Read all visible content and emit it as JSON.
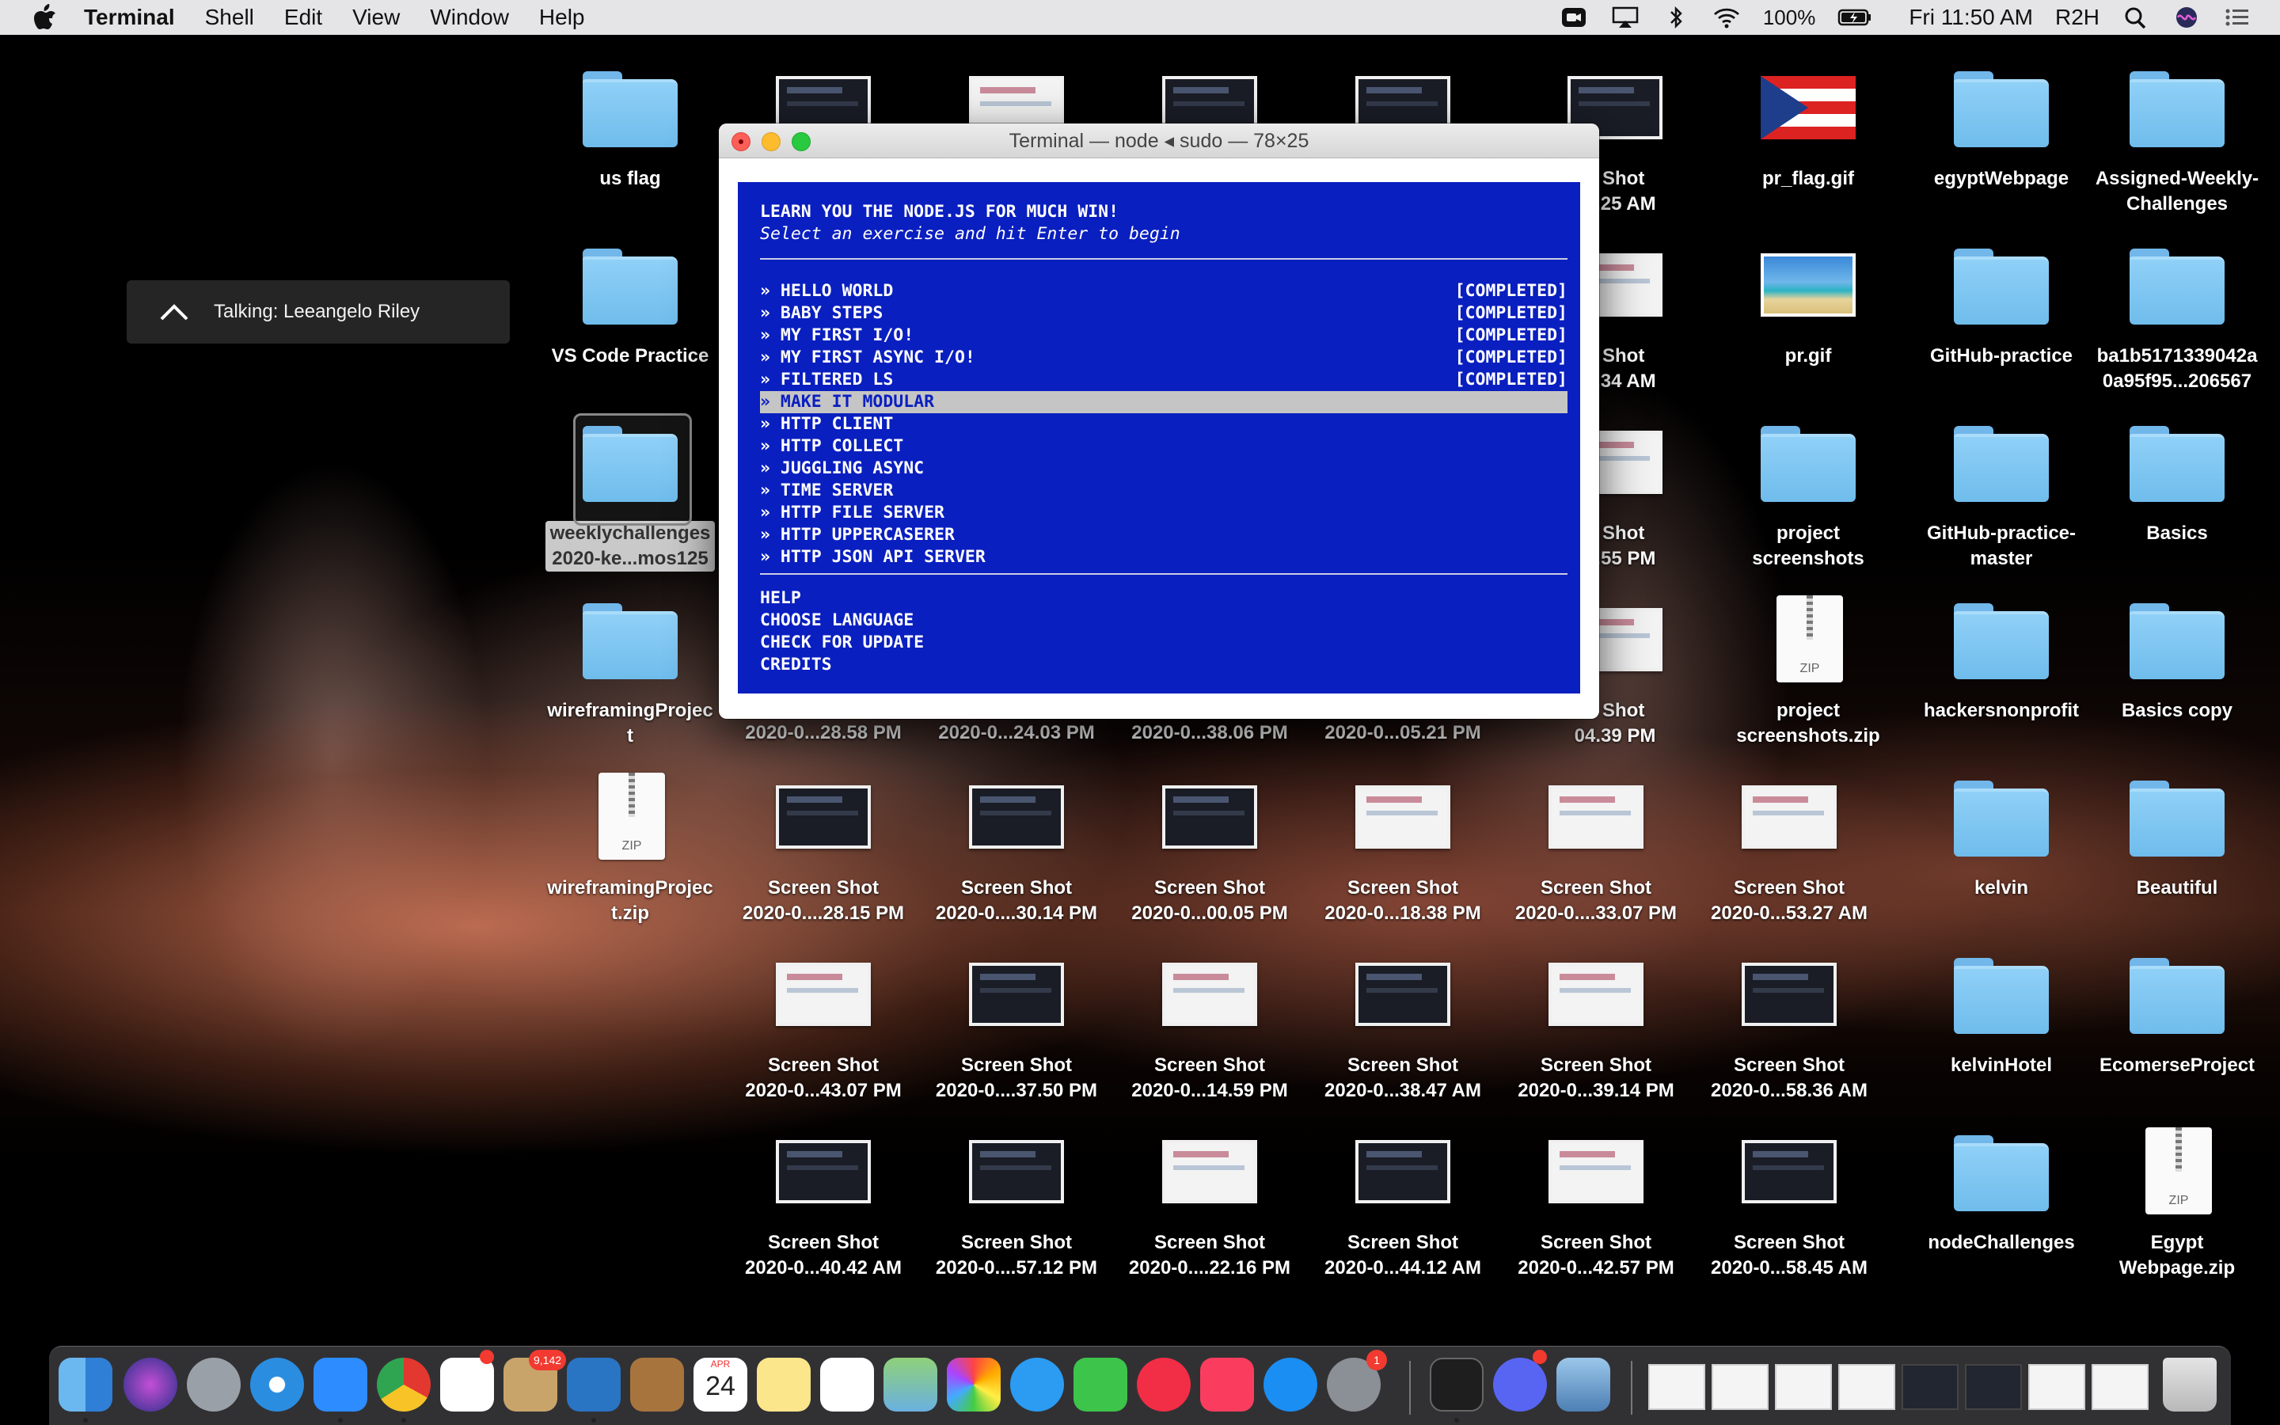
{
  "menubar": {
    "app": "Terminal",
    "items": [
      "Shell",
      "Edit",
      "View",
      "Window",
      "Help"
    ],
    "battery": "100%",
    "clock": "Fri 11:50 AM",
    "user": "R2H"
  },
  "notification": {
    "text": "Talking: Leeangelo Riley"
  },
  "desktop": {
    "icons": [
      {
        "label": "us flag"
      },
      {
        "label": "VS Code Practice"
      },
      {
        "label": "weeklychallenges\n2020-ke...mos125"
      },
      {
        "label": "wireframingProjec\nt"
      },
      {
        "label": "wireframingProjec\nt.zip",
        "zip_text": "ZIP"
      },
      {
        "label": "n Shot\n56.25 AM"
      },
      {
        "label": "n Shot\n56.34 AM"
      },
      {
        "label": "n Shot\n54.55 PM"
      },
      {
        "label": "n Shot\n04.39 PM"
      },
      {
        "label": "pr_flag.gif"
      },
      {
        "label": "pr.gif"
      },
      {
        "label": "project\nscreenshots"
      },
      {
        "label": "project\nscreenshots.zip",
        "zip_text": "ZIP"
      },
      {
        "label": "egyptWebpage"
      },
      {
        "label": "GitHub-practice"
      },
      {
        "label": "GitHub-practice-\nmaster"
      },
      {
        "label": "hackersnonprofit"
      },
      {
        "label": "kelvin"
      },
      {
        "label": "kelvinHotel"
      },
      {
        "label": "nodeChallenges"
      },
      {
        "label": "Assigned-Weekly-\nChallenges"
      },
      {
        "label": "ba1b5171339042a\n0a95f95...206567"
      },
      {
        "label": "Basics"
      },
      {
        "label": "Basics copy"
      },
      {
        "label": "Beautiful"
      },
      {
        "label": "EcomerseProject"
      },
      {
        "label": "Egypt\nWebpage.zip",
        "zip_text": "ZIP"
      },
      {
        "label": "2020-0...28.58 PM"
      },
      {
        "label": "2020-0...24.03 PM"
      },
      {
        "label": "2020-0...38.06 PM"
      },
      {
        "label": "2020-0...05.21 PM"
      },
      {
        "label": "Screen Shot\n2020-0....28.15 PM"
      },
      {
        "label": "Screen Shot\n2020-0....30.14 PM"
      },
      {
        "label": "Screen Shot\n2020-0...00.05 PM"
      },
      {
        "label": "Screen Shot\n2020-0...18.38 PM"
      },
      {
        "label": "Screen Shot\n2020-0....33.07 PM"
      },
      {
        "label": "Screen Shot\n2020-0...53.27 AM"
      },
      {
        "label": "Screen Shot\n2020-0...43.07 PM"
      },
      {
        "label": "Screen Shot\n2020-0....37.50 PM"
      },
      {
        "label": "Screen Shot\n2020-0...14.59 PM"
      },
      {
        "label": "Screen Shot\n2020-0...38.47 AM"
      },
      {
        "label": "Screen Shot\n2020-0...39.14 PM"
      },
      {
        "label": "Screen Shot\n2020-0...58.36 AM"
      },
      {
        "label": "Screen Shot\n2020-0...40.42 AM"
      },
      {
        "label": "Screen Shot\n2020-0....57.12 PM"
      },
      {
        "label": "Screen Shot\n2020-0....22.16 PM"
      },
      {
        "label": "Screen Shot\n2020-0...44.12 AM"
      },
      {
        "label": "Screen Shot\n2020-0...42.57 PM"
      },
      {
        "label": "Screen Shot\n2020-0...58.45 AM"
      }
    ]
  },
  "terminal": {
    "title": "Terminal — node ◂ sudo — 78×25",
    "heading": "LEARN YOU THE NODE.JS FOR MUCH WIN!",
    "subheading": "Select an exercise and hit Enter to begin",
    "exercises": [
      {
        "name": "» HELLO WORLD",
        "status": "[COMPLETED]"
      },
      {
        "name": "» BABY STEPS",
        "status": "[COMPLETED]"
      },
      {
        "name": "» MY FIRST I/O!",
        "status": "[COMPLETED]"
      },
      {
        "name": "» MY FIRST ASYNC I/O!",
        "status": "[COMPLETED]"
      },
      {
        "name": "» FILTERED LS",
        "status": "[COMPLETED]"
      },
      {
        "name": "» MAKE IT MODULAR",
        "status": ""
      },
      {
        "name": "» HTTP CLIENT",
        "status": ""
      },
      {
        "name": "» HTTP COLLECT",
        "status": ""
      },
      {
        "name": "» JUGGLING ASYNC",
        "status": ""
      },
      {
        "name": "» TIME SERVER",
        "status": ""
      },
      {
        "name": "» HTTP FILE SERVER",
        "status": ""
      },
      {
        "name": "» HTTP UPPERCASERER",
        "status": ""
      },
      {
        "name": "» HTTP JSON API SERVER",
        "status": ""
      }
    ],
    "selected_index": 5,
    "footer": [
      "HELP",
      "CHOOSE LANGUAGE",
      "CHECK FOR UPDATE",
      "CREDITS"
    ]
  },
  "dock": {
    "badges": {
      "slack": "",
      "mail": "9,142",
      "discord": "",
      "prefs": "1"
    },
    "calendar": {
      "month": "APR",
      "day": "24"
    }
  },
  "colors": {
    "terminal_bg": "#0a1fbf",
    "selection_bg": "#c5c5c5",
    "folder": "#7cc4f2"
  }
}
